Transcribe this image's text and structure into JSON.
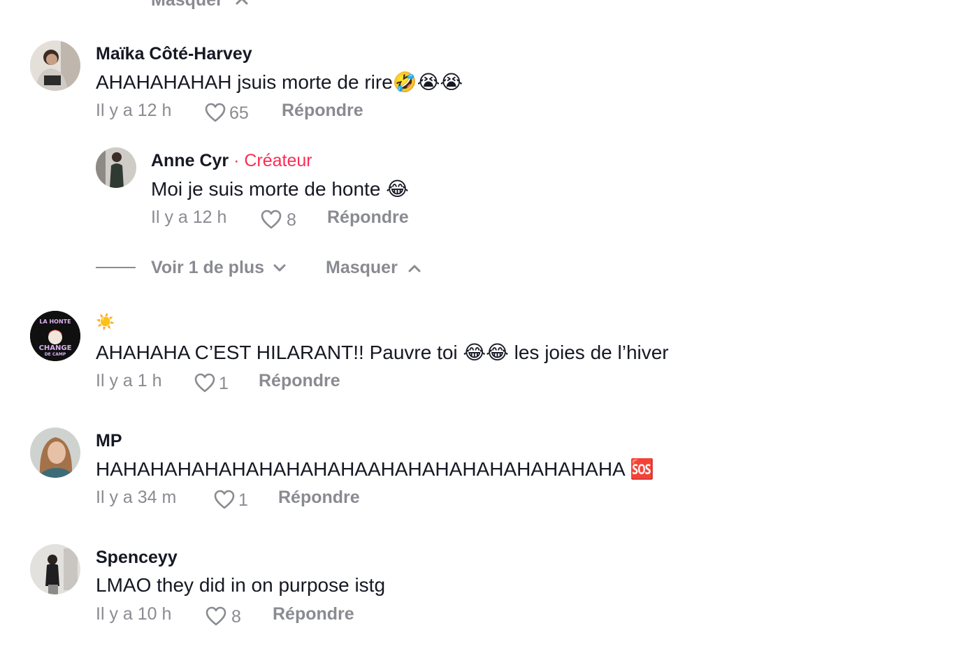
{
  "top_toggle": {
    "hide_label": "Masquer"
  },
  "comments": [
    {
      "name": "Maïka Côté-Harvey",
      "text": "AHAHAHAHAH jsuis morte de rire🤣😭😭",
      "time": "Il y a 12 h",
      "likes": "65",
      "reply_label": "Répondre"
    },
    {
      "name": "Anne Cyr",
      "badge": "· Créateur",
      "text": "Moi je suis morte de honte 😂",
      "time": "Il y a 12 h",
      "likes": "8",
      "reply_label": "Répondre"
    },
    {
      "name": "☀️",
      "avatar_text": {
        "line1": "LA HONTE",
        "line2": "CHANGE",
        "line3": "DE CAMP"
      },
      "text": "AHAHAHA C’EST HILARANT!! Pauvre toi 😂😂 les joies de l’hiver",
      "time": "Il y a 1 h",
      "likes": "1",
      "reply_label": "Répondre"
    },
    {
      "name": "MP",
      "text": "HAHAHAHAHAHAHAHAHAHAAHAHAHAHAHAHAHAHAHA 🆘",
      "time": "Il y a 34 m",
      "likes": "1",
      "reply_label": "Répondre"
    },
    {
      "name": "Spenceyy",
      "text": "LMAO they did in on purpose istg",
      "time": "Il y a 10 h",
      "likes": "8",
      "reply_label": "Répondre"
    }
  ],
  "thread_controls": {
    "more_label": "Voir 1 de plus",
    "hide_label": "Masquer"
  },
  "colors": {
    "accent": "#fe2c55",
    "muted": "#8a8b91",
    "text": "#161823"
  },
  "icons": [
    "heart-icon",
    "chevron-down-icon",
    "chevron-up-icon"
  ]
}
